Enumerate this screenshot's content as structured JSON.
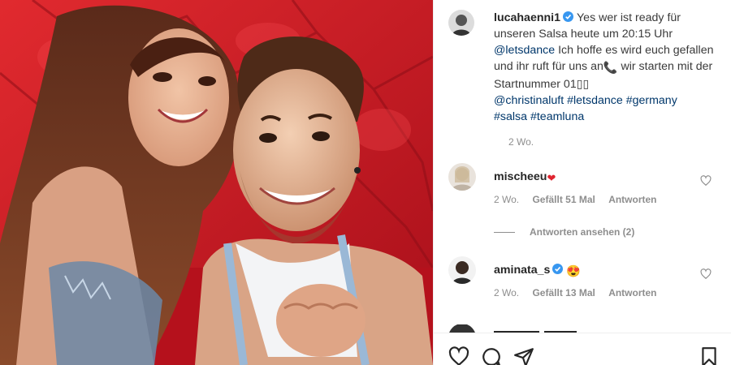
{
  "post": {
    "author": "lucahaenni1",
    "caption_parts": {
      "p1": "Yes wer ist ready für unseren Salsa heute um 20:15 Uhr ",
      "mention1": "@letsdance",
      "p2": " Ich hoffe es wird euch gefallen und ihr ruft für uns an",
      "phone_emoji": "📞",
      "p3": " wir starten mit der Startnummer 01",
      "trail_glyphs": "▯▯",
      "mention2": "@christinaluft",
      "hashtags": [
        "#letsdance",
        "#germany",
        "#salsa",
        "#teamluna"
      ]
    },
    "time": "2 Wo."
  },
  "comments": [
    {
      "user": "mischeeu",
      "text": "❤",
      "time": "2 Wo.",
      "likes": "Gefällt 51 Mal",
      "reply": "Antworten",
      "view_replies": "Antworten ansehen (2)"
    },
    {
      "user": "aminata_s",
      "text": "😍",
      "time": "2 Wo.",
      "likes": "Gefällt 13 Mal",
      "reply": "Antworten"
    }
  ],
  "actions": [
    "heart-icon",
    "comment-icon",
    "share-icon",
    "bookmark-icon"
  ],
  "colors": {
    "text": "#262626",
    "secondary": "#8e8e8e",
    "link": "#00376b",
    "verified": "#3897f0",
    "background_red": "#c41a24"
  }
}
